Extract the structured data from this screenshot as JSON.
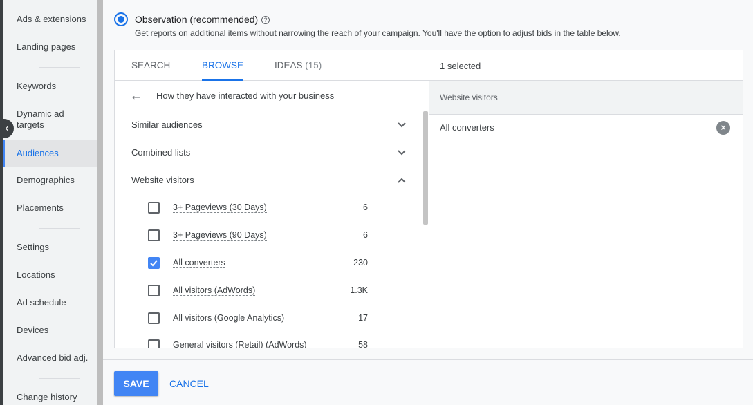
{
  "sidebar": {
    "items": [
      {
        "label": "Ads & extensions"
      },
      {
        "label": "Landing pages"
      },
      {
        "label": "Keywords"
      },
      {
        "label": "Dynamic ad targets"
      },
      {
        "label": "Audiences"
      },
      {
        "label": "Demographics"
      },
      {
        "label": "Placements"
      },
      {
        "label": "Settings"
      },
      {
        "label": "Locations"
      },
      {
        "label": "Ad schedule"
      },
      {
        "label": "Devices"
      },
      {
        "label": "Advanced bid adj."
      },
      {
        "label": "Change history"
      }
    ],
    "active": "Audiences"
  },
  "observation": {
    "title": "Observation (recommended)",
    "description": "Get reports on additional items without narrowing the reach of your campaign. You'll have the option to adjust bids in the table below."
  },
  "tabs": [
    {
      "label": "SEARCH"
    },
    {
      "label": "BROWSE"
    },
    {
      "label": "IDEAS",
      "count": "(15)"
    }
  ],
  "browse": {
    "path": "How they have interacted with your business"
  },
  "categories": [
    {
      "label": "Similar audiences",
      "expanded": false
    },
    {
      "label": "Combined lists",
      "expanded": false
    },
    {
      "label": "Website visitors",
      "expanded": true
    }
  ],
  "items": [
    {
      "label": "3+ Pageviews (30 Days)",
      "count": "6",
      "checked": false
    },
    {
      "label": "3+ Pageviews (90 Days)",
      "count": "6",
      "checked": false
    },
    {
      "label": "All converters",
      "count": "230",
      "checked": true
    },
    {
      "label": "All visitors (AdWords)",
      "count": "1.3K",
      "checked": false
    },
    {
      "label": "All visitors (Google Analytics)",
      "count": "17",
      "checked": false
    },
    {
      "label": "General visitors (Retail) (AdWords)",
      "count": "58",
      "checked": false
    }
  ],
  "selection": {
    "count_label": "1 selected",
    "group": "Website visitors",
    "items": [
      {
        "label": "All converters"
      }
    ]
  },
  "footer": {
    "save_label": "SAVE",
    "cancel_label": "CANCEL"
  },
  "colors": {
    "accent": "#1a73e8",
    "primary_button": "#4285f4"
  }
}
